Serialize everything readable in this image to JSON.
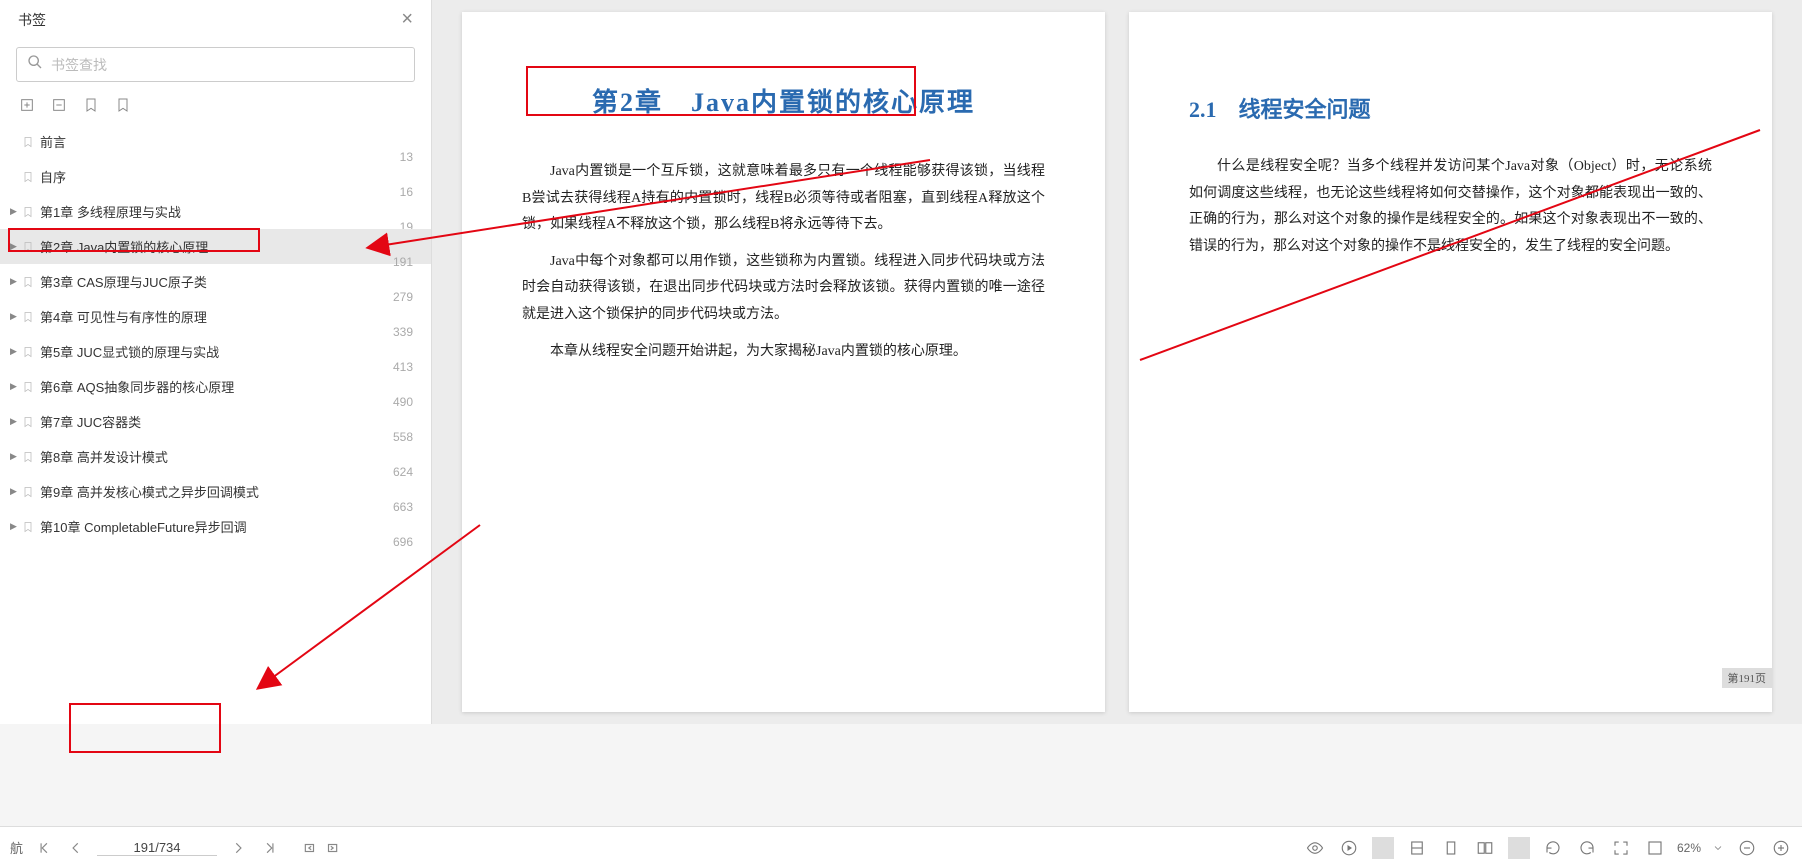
{
  "sidebar": {
    "title": "书签",
    "search_placeholder": "书签查找",
    "items": [
      {
        "label": "前言",
        "page": "13",
        "expandable": false
      },
      {
        "label": "自序",
        "page": "16",
        "expandable": false
      },
      {
        "label": "第1章 多线程原理与实战",
        "page": "19",
        "expandable": true
      },
      {
        "label": "第2章 Java内置锁的核心原理",
        "page": "191",
        "expandable": true,
        "active": true
      },
      {
        "label": "第3章 CAS原理与JUC原子类",
        "page": "279",
        "expandable": true
      },
      {
        "label": "第4章 可见性与有序性的原理",
        "page": "339",
        "expandable": true
      },
      {
        "label": "第5章 JUC显式锁的原理与实战",
        "page": "413",
        "expandable": true
      },
      {
        "label": "第6章 AQS抽象同步器的核心原理",
        "page": "490",
        "expandable": true
      },
      {
        "label": "第7章 JUC容器类",
        "page": "558",
        "expandable": true
      },
      {
        "label": "第8章 高并发设计模式",
        "page": "624",
        "expandable": true
      },
      {
        "label": "第9章 高并发核心模式之异步回调模式",
        "page": "663",
        "expandable": true
      },
      {
        "label": "第10章 CompletableFuture异步回调",
        "page": "696",
        "expandable": true
      }
    ]
  },
  "doc": {
    "left_page": {
      "chapter_title": "第2章　Java内置锁的核心原理",
      "p1": "Java内置锁是一个互斥锁，这就意味着最多只有一个线程能够获得该锁，当线程B尝试去获得线程A持有的内置锁时，线程B必须等待或者阻塞，直到线程A释放这个锁，如果线程A不释放这个锁，那么线程B将永远等待下去。",
      "p2": "Java中每个对象都可以用作锁，这些锁称为内置锁。线程进入同步代码块或方法时会自动获得该锁，在退出同步代码块或方法时会释放该锁。获得内置锁的唯一途径就是进入这个锁保护的同步代码块或方法。",
      "p3": "本章从线程安全问题开始讲起，为大家揭秘Java内置锁的核心原理。"
    },
    "right_page": {
      "section_title": "2.1　线程安全问题",
      "p1": "什么是线程安全呢？当多个线程并发访问某个Java对象（Object）时，无论系统如何调度这些线程，也无论这些线程将如何交替操作，这个对象都能表现出一致的、正确的行为，那么对这个对象的操作是线程安全的。如果这个对象表现出不一致的、错误的行为，那么对这个对象的操作不是线程安全的，发生了线程的安全问题。",
      "badge": "第191页"
    }
  },
  "footer": {
    "nav_label": "航",
    "page_display": "191/734",
    "zoom": "62%"
  }
}
